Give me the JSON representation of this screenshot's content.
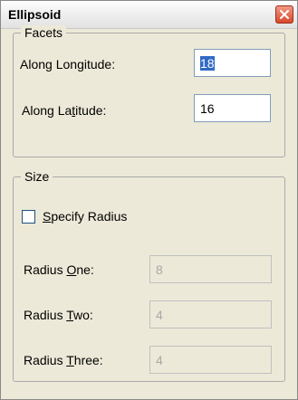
{
  "window": {
    "title": "Ellipsoid"
  },
  "facets": {
    "legend": "Facets",
    "longitude_label_pre": "Along Lon",
    "longitude_label_key": "g",
    "longitude_label_post": "itude:",
    "longitude_value": "18",
    "latitude_label_pre": "Along La",
    "latitude_label_key": "t",
    "latitude_label_post": "itude:",
    "latitude_value": "16"
  },
  "size": {
    "legend": "Size",
    "specify_radius_key": "S",
    "specify_radius_rest": "pecify Radius",
    "specify_radius_checked": false,
    "radius_one_pre": "Radius ",
    "radius_one_key": "O",
    "radius_one_post": "ne:",
    "radius_one_value": "8",
    "radius_two_pre": "Radius ",
    "radius_two_key": "T",
    "radius_two_post": "wo:",
    "radius_two_value": "4",
    "radius_three_pre": "Radius ",
    "radius_three_key": "T",
    "radius_three_post": "hree:",
    "radius_three_value": "4"
  },
  "colors": {
    "accent": "#316ac5",
    "close_button": "#d9482b"
  },
  "icons": {
    "close": "close-icon"
  }
}
